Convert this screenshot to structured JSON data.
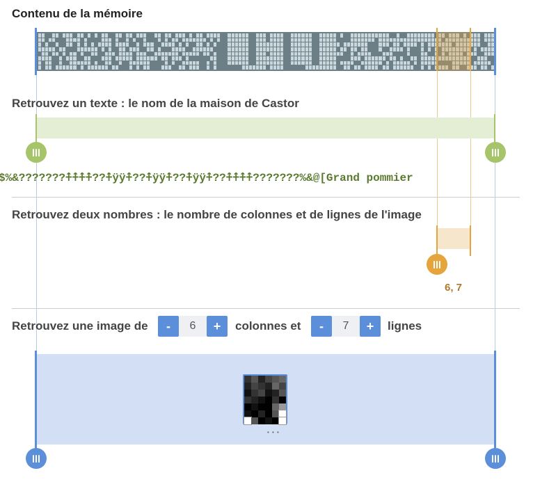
{
  "memory": {
    "title": "Contenu de la mémoire"
  },
  "text_section": {
    "title": "Retrouvez un texte : le nom de la maison de Castor",
    "decoded": "$%&???????⍏⍏⍏⍏??⍏ÿÿ⍏??⍏ÿÿ⍏??⍏ÿÿ⍏??⍏⍏⍏⍏???????%&@[Grand pommier"
  },
  "numbers_section": {
    "title": "Retrouvez deux nombres : le nombre de colonnes et de lignes de l'image",
    "result": "6, 7"
  },
  "image_section": {
    "label_prefix": "Retrouvez une image de",
    "columns_label": "colonnes et",
    "rows_label": "lignes",
    "minus": "-",
    "plus": "+",
    "columns": "6",
    "rows": "7",
    "more": "• • •"
  },
  "colors": {
    "memory_bg": "#6c7f86",
    "memory_cell": "#c9d6dc",
    "green": "#a6c46a",
    "green_fill": "#e4eed4",
    "orange": "#e5a43c",
    "orange_fill": "#f5e6cc",
    "blue": "#5b8fd9",
    "blue_fill": "#d3dff5"
  },
  "image_pixels": [
    [
      "#333",
      "#555",
      "#222",
      "#444",
      "#555",
      "#666"
    ],
    [
      "#222",
      "#444",
      "#333",
      "#222",
      "#666",
      "#444"
    ],
    [
      "#111",
      "#333",
      "#444",
      "#111",
      "#222",
      "#555"
    ],
    [
      "#333",
      "#222",
      "#111",
      "#000",
      "#333",
      "#000"
    ],
    [
      "#000",
      "#111",
      "#000",
      "#000",
      "#666",
      "#999"
    ],
    [
      "#111",
      "#000",
      "#222",
      "#000",
      "#555",
      "#fff"
    ],
    [
      "#fff",
      "#555",
      "#000",
      "#111",
      "#000",
      "#fff"
    ]
  ]
}
